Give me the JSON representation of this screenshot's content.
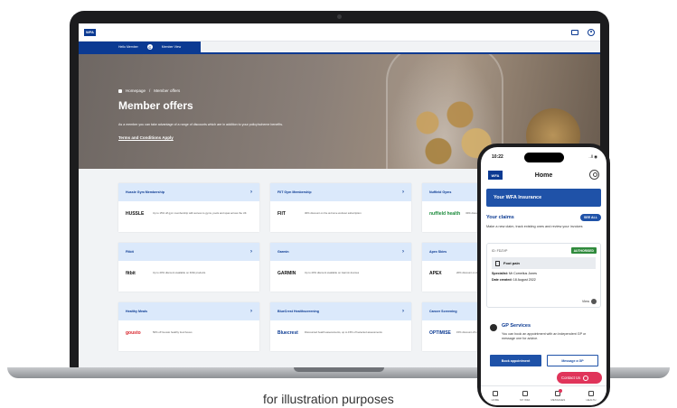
{
  "laptop": {
    "header": {
      "logo": "WFA"
    },
    "member_bar": {
      "label": "Hello Member",
      "badge": "C",
      "text": "Member View"
    },
    "hero": {
      "breadcrumb": [
        "Homepage",
        "/",
        "Member offers"
      ],
      "title": "Member offers",
      "description": "As a member you can take advantage of a range of discounts which are in addition to your policy/scheme benefits.",
      "terms_link": "Terms and Conditions Apply"
    },
    "offers": [
      {
        "title": "Hussle Gym Membership",
        "brand": "HUSSLE",
        "desc": "Up to 15% off gym membership with access to gyms, pools and spas across the UK",
        "brand_color": "#f2b705"
      },
      {
        "title": "FIIT Gym Membership",
        "brand": "FIIT",
        "desc": "30% discount on the at-home workout subscription",
        "brand_color": "#111111"
      },
      {
        "title": "Nuffield Gyms",
        "brand": "nuffield health",
        "desc": "30% discount on Nuffield Health memberships",
        "brand_color": "#1a8a3a"
      },
      {
        "title": "Fitbit",
        "brand": "fitbit",
        "desc": "Up to 20% discount available on Fitbit products",
        "brand_color": "#111111"
      },
      {
        "title": "Garmin",
        "brand": "GARMIN",
        "desc": "Up to 20% discount available on Garmin devices",
        "brand_color": "#111111"
      },
      {
        "title": "Apex Skies",
        "brand": "APEX",
        "desc": "20% discount on Apex Skies",
        "brand_color": "#111111"
      },
      {
        "title": "Healthy Meals",
        "brand": "gousto",
        "desc": "50% off Gousto healthy food boxes",
        "brand_color": "#d8232a"
      },
      {
        "title": "BlueCrest Healthscreening",
        "brand": "Bluecrest",
        "desc": "Discounted health assessments, up to 15% off selected assessments",
        "brand_color": "#0b3a92"
      },
      {
        "title": "Cancer Screening",
        "brand": "OPTIMISE",
        "desc": "15% discount off cancer screening",
        "brand_color": "#0b3a92"
      }
    ]
  },
  "phone": {
    "status_time": "10:22",
    "status_icons": "..ll ◉",
    "app_logo": "WFA",
    "app_title": "Home",
    "insurance_banner": "Your WFA Insurance",
    "claims": {
      "title": "Your claims",
      "see_all": "SEE ALL",
      "description": "Make a new claim, track existing ones and review your invoices",
      "claim_id": "ID: FDZVP",
      "status": "AUTHORISED",
      "type": "Foot pain",
      "specialist_label": "Specialist:",
      "specialist": "Mr Cornelius Jones",
      "date_label": "Date created:",
      "date": "18 August 2022",
      "view": "View"
    },
    "gp": {
      "title": "GP Services",
      "description": "You can book an appointment with an independent GP or message one for advice."
    },
    "buttons": {
      "book": "Book appointment",
      "message": "Message a GP",
      "contact": "Contact Us"
    },
    "tabs": [
      {
        "label": "HOME"
      },
      {
        "label": "MY WFA"
      },
      {
        "label": "MESSAGES"
      },
      {
        "label": "HEALTH"
      }
    ]
  },
  "caption": "for illustration purposes"
}
